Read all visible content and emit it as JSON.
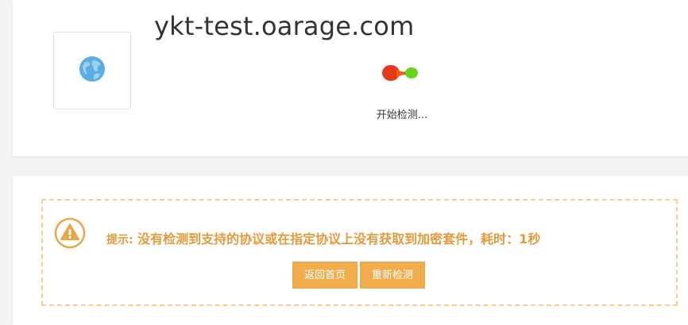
{
  "site": {
    "title": "ykt-test.oarage.com",
    "icon": "globe-icon"
  },
  "scan": {
    "status_text": "开始检测..."
  },
  "alert": {
    "icon": "warning-icon",
    "prefix": "提示:",
    "message": " 没有检测到支持的协议或在指定协议上没有获取到加密套件，耗时：1秒",
    "buttons": {
      "home": "返回首页",
      "retest": "重新检测"
    }
  },
  "colors": {
    "accent": "#f0ad4e",
    "alert_text": "#e29a3b",
    "alert_border": "#f3cf8f",
    "loader_red": "#e23a1a",
    "loader_green": "#6ad41c",
    "globe_blue": "#4aa3df"
  }
}
